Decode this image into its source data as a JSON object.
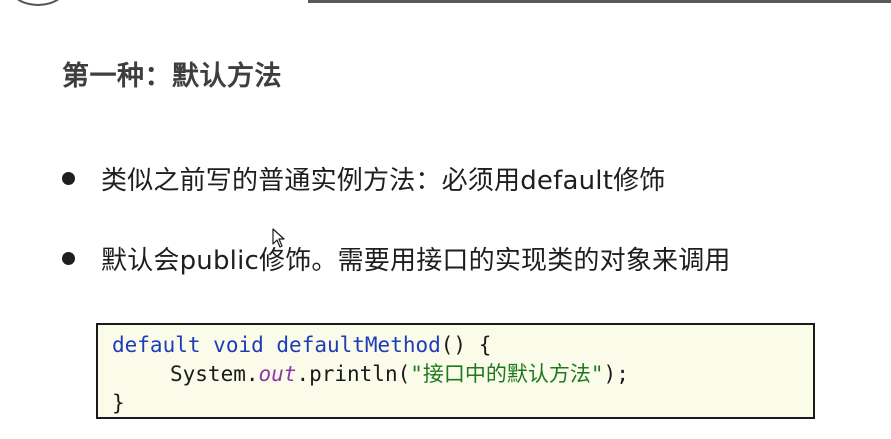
{
  "slide": {
    "title": "第一种：默认方法",
    "bullets": [
      {
        "text": "类似之前写的普通实例方法：必须用default修饰"
      },
      {
        "text": "默认会public修饰。需要用接口的实现类的对象来调用"
      }
    ]
  },
  "code": {
    "line1": {
      "keyword_default": "default",
      "space1": " ",
      "keyword_void": "void",
      "space2": " ",
      "method_name": "defaultMethod",
      "rest": "() {"
    },
    "line2": {
      "prefix": "System.",
      "field": "out",
      "call": ".println(",
      "string": "\"接口中的默认方法\"",
      "suffix": ");"
    },
    "line3": {
      "text": "}"
    }
  },
  "colors": {
    "keyword": "#1f3cb8",
    "field": "#8a3aa8",
    "string": "#1c7a1c",
    "code_background": "#fbfbe9"
  },
  "icons": {
    "cursor": "mouse-pointer-icon"
  }
}
